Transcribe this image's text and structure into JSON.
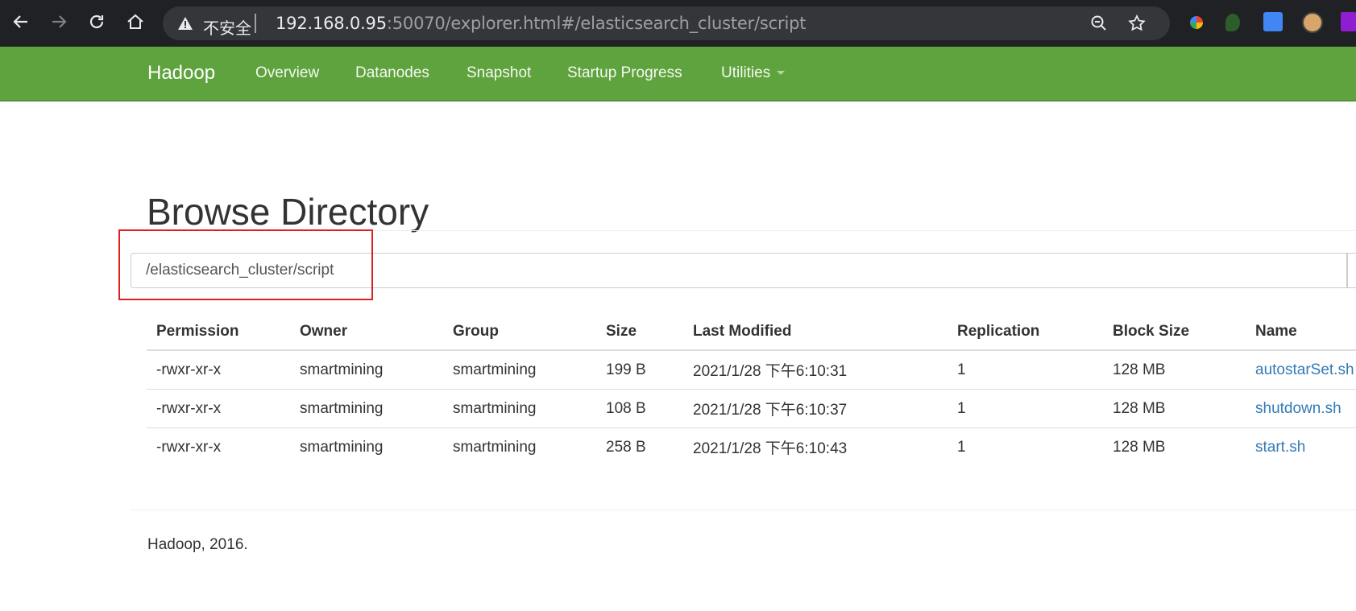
{
  "browser": {
    "insecure_label": "不安全",
    "url_host": "192.168.0.95",
    "url_rest": ":50070/explorer.html#/elasticsearch_cluster/script"
  },
  "navbar": {
    "brand": "Hadoop",
    "items": [
      {
        "label": "Overview"
      },
      {
        "label": "Datanodes"
      },
      {
        "label": "Snapshot"
      },
      {
        "label": "Startup Progress"
      },
      {
        "label": "Utilities"
      }
    ],
    "color": "#5fa33e"
  },
  "page": {
    "title": "Browse Directory",
    "path_value": "/elasticsearch_cluster/script"
  },
  "table": {
    "headers": [
      "Permission",
      "Owner",
      "Group",
      "Size",
      "Last Modified",
      "Replication",
      "Block Size",
      "Name"
    ],
    "rows": [
      {
        "permission": "-rwxr-xr-x",
        "owner": "smartmining",
        "group": "smartmining",
        "size": "199 B",
        "modified": "2021/1/28 下午6:10:31",
        "replication": "1",
        "block_size": "128 MB",
        "name": "autostarSet.sh"
      },
      {
        "permission": "-rwxr-xr-x",
        "owner": "smartmining",
        "group": "smartmining",
        "size": "108 B",
        "modified": "2021/1/28 下午6:10:37",
        "replication": "1",
        "block_size": "128 MB",
        "name": "shutdown.sh"
      },
      {
        "permission": "-rwxr-xr-x",
        "owner": "smartmining",
        "group": "smartmining",
        "size": "258 B",
        "modified": "2021/1/28 下午6:10:43",
        "replication": "1",
        "block_size": "128 MB",
        "name": "start.sh"
      }
    ]
  },
  "footer": {
    "text": "Hadoop, 2016."
  },
  "colors": {
    "link": "#337ab7",
    "highlight": "#e02020"
  }
}
